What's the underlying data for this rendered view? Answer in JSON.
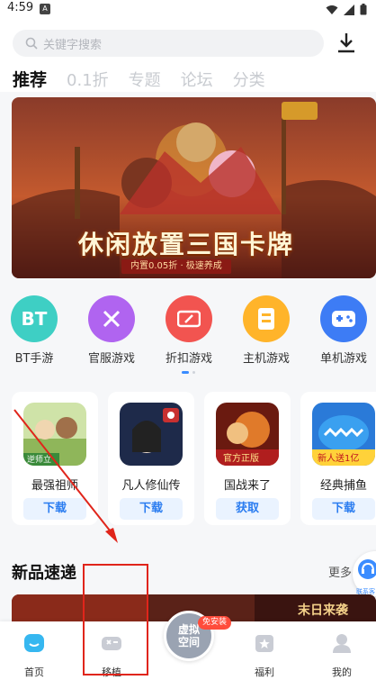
{
  "status": {
    "time": "4:59"
  },
  "search": {
    "placeholder": "关键字搜索"
  },
  "tabs": [
    "推荐",
    "0.1折",
    "专题",
    "论坛",
    "分类"
  ],
  "banner": {
    "title": "休闲放置三国卡牌",
    "subtitle": "内置0.05折 · 极速养成"
  },
  "categories": [
    {
      "label": "BT手游",
      "icon": "bt-icon",
      "color": "#3ecfc4",
      "glyph": "BT"
    },
    {
      "label": "官服游戏",
      "icon": "crossed-swords-icon",
      "color": "#b064f0",
      "glyph": "✕"
    },
    {
      "label": "折扣游戏",
      "icon": "discount-ticket-icon",
      "color": "#f25450",
      "glyph": "%"
    },
    {
      "label": "主机游戏",
      "icon": "console-box-icon",
      "color": "#ffb42a",
      "glyph": "▦"
    },
    {
      "label": "单机游戏",
      "icon": "gamepad-icon",
      "color": "#3d7cf5",
      "glyph": "⊞"
    }
  ],
  "games": [
    {
      "name": "最强祖师",
      "button": "下载",
      "icon_badge": "逆师立"
    },
    {
      "name": "凡人修仙传",
      "button": "下载",
      "icon_badge": ""
    },
    {
      "name": "国战来了",
      "button": "获取",
      "icon_badge": "官方正版"
    },
    {
      "name": "经典捕鱼",
      "button": "下载",
      "icon_badge": "新人送1亿"
    }
  ],
  "section": {
    "title": "新品速递",
    "more": "更多",
    "service": "联系客服"
  },
  "promo_text": "末日来袭",
  "bottom_nav": {
    "home": "首页",
    "port": "移植",
    "center_line1": "虚拟",
    "center_line2": "空间",
    "center_badge": "免安装",
    "welfare": "福利",
    "mine": "我的"
  },
  "colors": {
    "accent": "#3a8cff",
    "annotation": "#e0251b"
  }
}
